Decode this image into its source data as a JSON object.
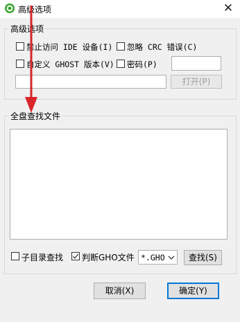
{
  "window": {
    "title": "高级选项",
    "close_glyph": "✕"
  },
  "advanced_group": {
    "label": "高级选项",
    "options": [
      {
        "label": "禁止访问 IDE 设备(I)",
        "checked": false
      },
      {
        "label": "忽略 CRC 错误(C)",
        "checked": false
      },
      {
        "label": "自定义 GHOST 版本(V)",
        "checked": false
      },
      {
        "label": "密码(P)",
        "checked": false
      }
    ],
    "password_value": "",
    "path_value": "",
    "open_button": "打开(P)"
  },
  "search_group": {
    "label": "全盘查找文件",
    "subdir_label": "子目录查找",
    "gho_label": "判断GHO文件",
    "ext_value": "*.GHO",
    "find_button": "查找(S)"
  },
  "footer": {
    "cancel_button": "取消(X)",
    "ok_button": "确定(Y)"
  },
  "icons": {
    "app": "green-circle-icon",
    "arrow_color": "#d9262b"
  }
}
